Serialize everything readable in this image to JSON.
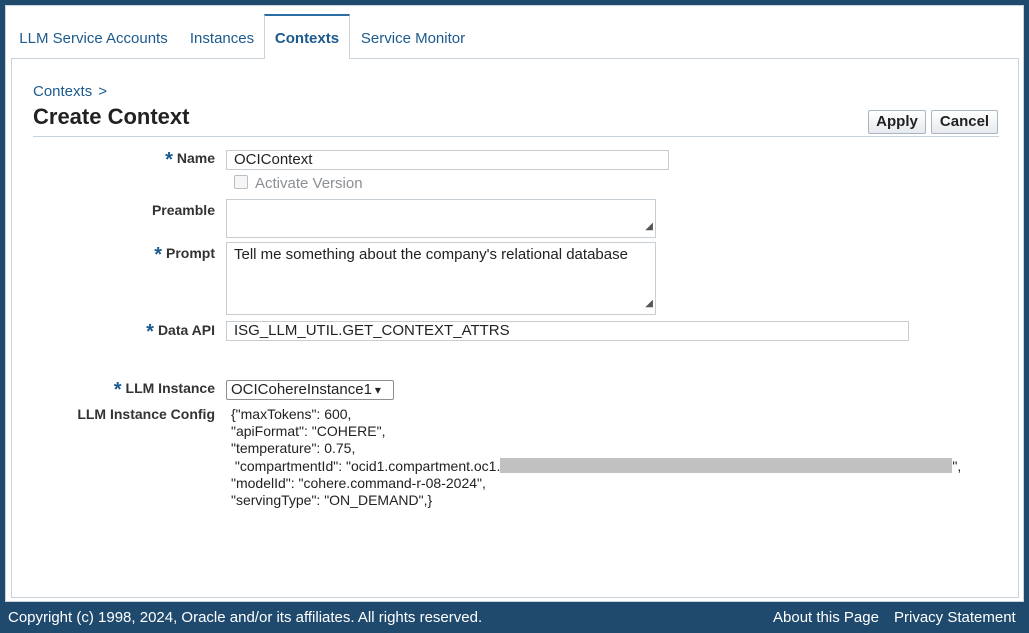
{
  "tabs": [
    {
      "label": "LLM Service Accounts"
    },
    {
      "label": "Instances"
    },
    {
      "label": "Contexts"
    },
    {
      "label": "Service Monitor"
    }
  ],
  "breadcrumb": {
    "item": "Contexts",
    "separator": ">"
  },
  "page_title": "Create Context",
  "buttons": {
    "apply": "Apply",
    "cancel": "Cancel"
  },
  "form": {
    "name": {
      "label": "Name",
      "value": "OCIContext"
    },
    "activate_version": {
      "label": "Activate Version",
      "checked": false
    },
    "preamble": {
      "label": "Preamble",
      "value": ""
    },
    "prompt": {
      "label": "Prompt",
      "value": "Tell me something about the company's relational database"
    },
    "data_api": {
      "label": "Data API",
      "value": "ISG_LLM_UTIL.GET_CONTEXT_ATTRS"
    },
    "llm_instance": {
      "label": "LLM Instance",
      "value": "OCICohereInstance1"
    },
    "llm_instance_config": {
      "label": "LLM Instance Config",
      "lines": [
        "{\"maxTokens\": 600,",
        "\"apiFormat\": \"COHERE\",",
        "\"temperature\": 0.75,",
        " \"compartmentId\": \"ocid1.compartment.oc1.",
        "\"modelId\": \"cohere.command-r-08-2024\",",
        "\"servingType\": \"ON_DEMAND\",}"
      ],
      "line4_suffix": "\","
    }
  },
  "footer": {
    "copyright": "Copyright (c) 1998, 2024, Oracle and/or its affiliates. All rights reserved.",
    "about": "About this Page",
    "privacy": "Privacy Statement"
  },
  "colors": {
    "header_bg": "#1f4a6e",
    "link": "#1c5a8e",
    "required": "#1c5a8e"
  }
}
